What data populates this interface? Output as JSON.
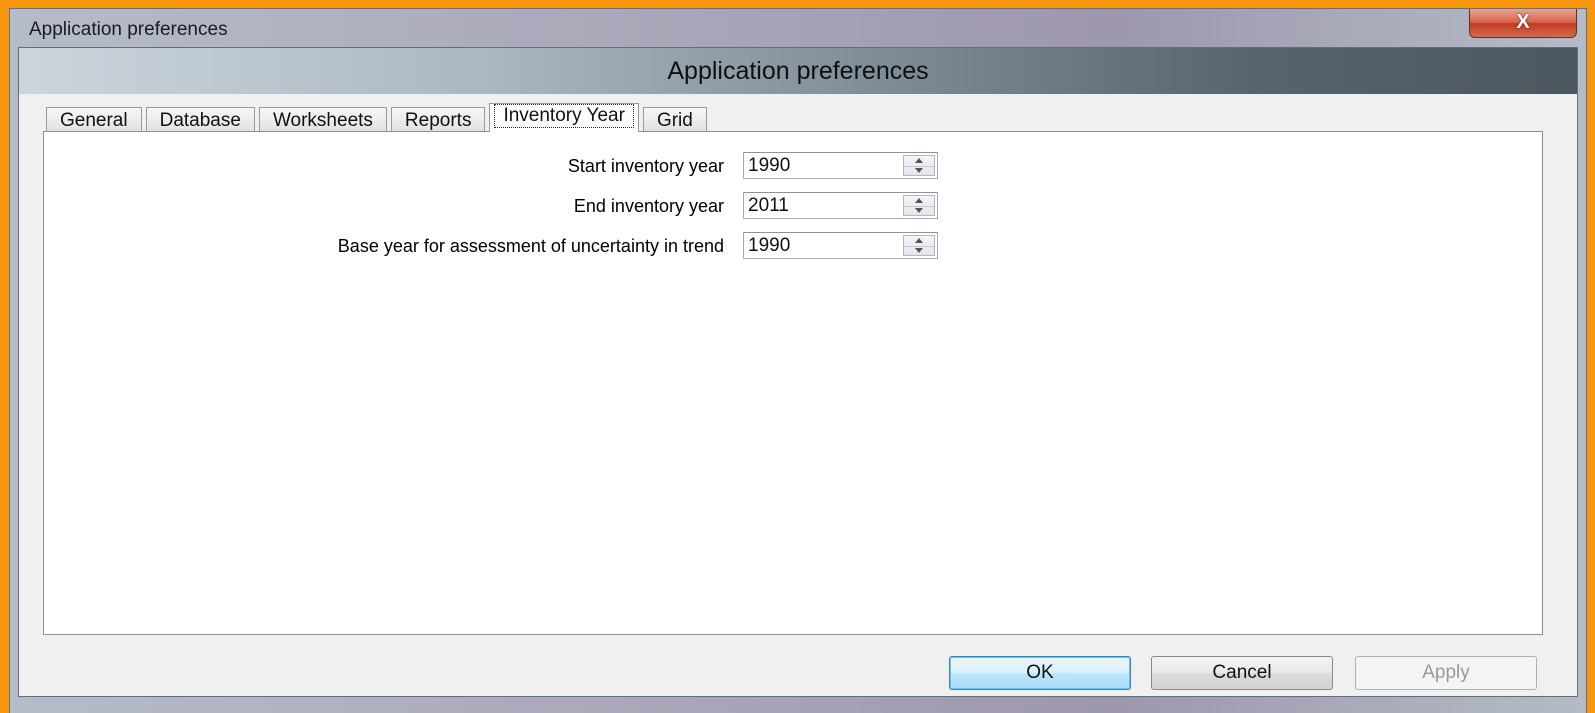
{
  "window": {
    "title": "Application preferences",
    "close_label": "X"
  },
  "banner": {
    "title": "Application preferences"
  },
  "tabs": [
    {
      "label": "General"
    },
    {
      "label": "Database"
    },
    {
      "label": "Worksheets"
    },
    {
      "label": "Reports"
    },
    {
      "label": "Inventory Year",
      "active": true
    },
    {
      "label": "Grid"
    }
  ],
  "fields": {
    "start_year": {
      "label": "Start inventory year",
      "value": "1990"
    },
    "end_year": {
      "label": "End inventory year",
      "value": "2011"
    },
    "base_year": {
      "label": "Base year for assessment of uncertainty in trend",
      "value": "1990"
    }
  },
  "buttons": {
    "ok": "OK",
    "cancel": "Cancel",
    "apply": "Apply"
  },
  "colors": {
    "background": "#f7950f",
    "ok_border": "#3c7fb1",
    "close_button": "#c23a1f"
  }
}
